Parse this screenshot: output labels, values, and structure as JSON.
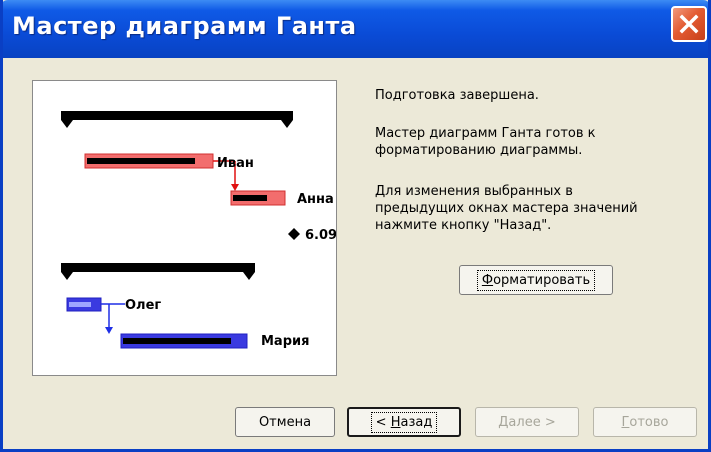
{
  "window": {
    "title": "Мастер диаграмм Ганта"
  },
  "preview": {
    "tasks": [
      {
        "name": "Иван"
      },
      {
        "name": "Анна"
      },
      {
        "name": "Олег"
      },
      {
        "name": "Мария"
      }
    ],
    "milestone": {
      "label": "6.09"
    },
    "colors": {
      "group_a": "#f26d6d",
      "group_b": "#3a3ae0",
      "link_a": "#e01010",
      "link_b": "#1f2fe6",
      "summary": "#000000"
    }
  },
  "message": {
    "line1": "Подготовка завершена.",
    "para2": [
      "Мастер диаграмм Ганта готов к",
      "форматированию диаграммы."
    ],
    "para3": [
      "Для изменения выбранных в",
      "предыдущих окнах мастера значений",
      "нажмите кнопку \"Назад\"."
    ]
  },
  "buttons": {
    "format": {
      "underlined": "Ф",
      "rest": "орматировать"
    },
    "cancel": "Отмена",
    "back": {
      "prefix": "< ",
      "underlined": "Н",
      "rest": "азад"
    },
    "next": {
      "underlined": "Д",
      "rest": "алее >"
    },
    "finish": {
      "underlined": "Г",
      "rest": "отово"
    }
  },
  "icons": {
    "close": "close-icon",
    "milestone": "diamond-icon"
  }
}
